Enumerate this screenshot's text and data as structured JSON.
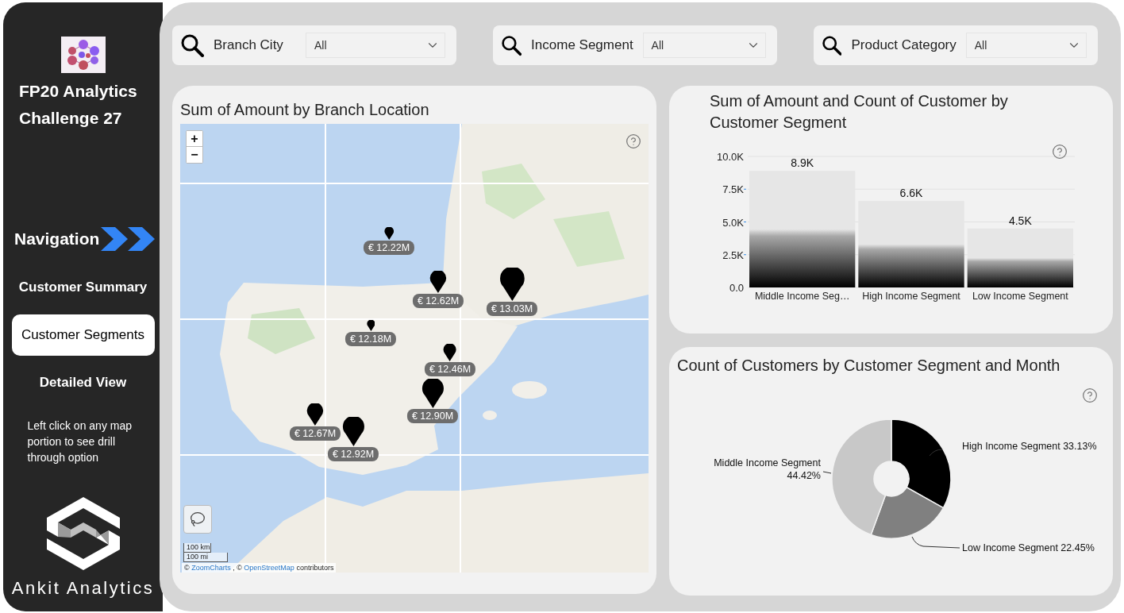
{
  "sidebar": {
    "title_lines": [
      "FP20 Analytics",
      "Challenge 27"
    ],
    "navigation_heading": "Navigation",
    "nav_items": [
      {
        "label": "Customer Summary",
        "selected": false
      },
      {
        "label": "Customer Segments",
        "selected": true
      },
      {
        "label": "Detailed View",
        "selected": false
      }
    ],
    "hint": "Left click on any map portion to see drill through option",
    "brand": "Ankit Analytics"
  },
  "filters": [
    {
      "label": "Branch City",
      "value": "All"
    },
    {
      "label": "Income Segment",
      "value": "All"
    },
    {
      "label": "Product Category",
      "value": "All"
    }
  ],
  "map_card": {
    "title": "Sum of Amount by Branch Location",
    "zoom_in": "+",
    "zoom_out": "−",
    "markers": [
      {
        "label": "€ 12.22M"
      },
      {
        "label": "€ 12.62M"
      },
      {
        "label": "€ 13.03M"
      },
      {
        "label": "€ 12.18M"
      },
      {
        "label": "€ 12.46M"
      },
      {
        "label": "€ 12.90M"
      },
      {
        "label": "€ 12.67M"
      },
      {
        "label": "€ 12.92M"
      }
    ],
    "scale": [
      "100 km",
      "100 mi"
    ],
    "attribution": [
      {
        "kind": "text",
        "text": "©"
      },
      {
        "kind": "link",
        "text": "ZoomCharts"
      },
      {
        "kind": "text",
        "text": ", ©"
      },
      {
        "kind": "link",
        "text": "OpenStreetMap"
      },
      {
        "kind": "text",
        "text": "contributors"
      }
    ]
  },
  "bar_card": {
    "title": "Sum of Amount and Count of Customer by Customer Segment",
    "chart_data": {
      "type": "bar",
      "categories": [
        "Middle Income Seg…",
        "High Income Segment",
        "Low Income Segment"
      ],
      "values": [
        8900,
        6600,
        4500
      ],
      "grid": true,
      "value_labels": [
        "8.9K",
        "6.6K",
        "4.5K"
      ],
      "ylim": [
        0,
        10000
      ],
      "yticks": [
        {
          "value": 0,
          "label": "0.0"
        },
        {
          "value": 2500,
          "label": "2.5K"
        },
        {
          "value": 5000,
          "label": "5.0K"
        },
        {
          "value": 7500,
          "label": "7.5K"
        },
        {
          "value": 10000,
          "label": "10.0K"
        }
      ]
    }
  },
  "donut_card": {
    "title": "Count of Customers by Customer Segment and Month",
    "chart_data": {
      "type": "donut",
      "categories": [
        "High Income Segment",
        "Low Income Segment",
        "Middle Income Segment"
      ],
      "values": [
        33.13,
        22.45,
        44.42
      ],
      "colors": [
        "#000000",
        "#808080",
        "#c8c8c8"
      ],
      "value_labels": [
        "33.13%",
        "22.45%",
        "44.42%"
      ]
    }
  }
}
